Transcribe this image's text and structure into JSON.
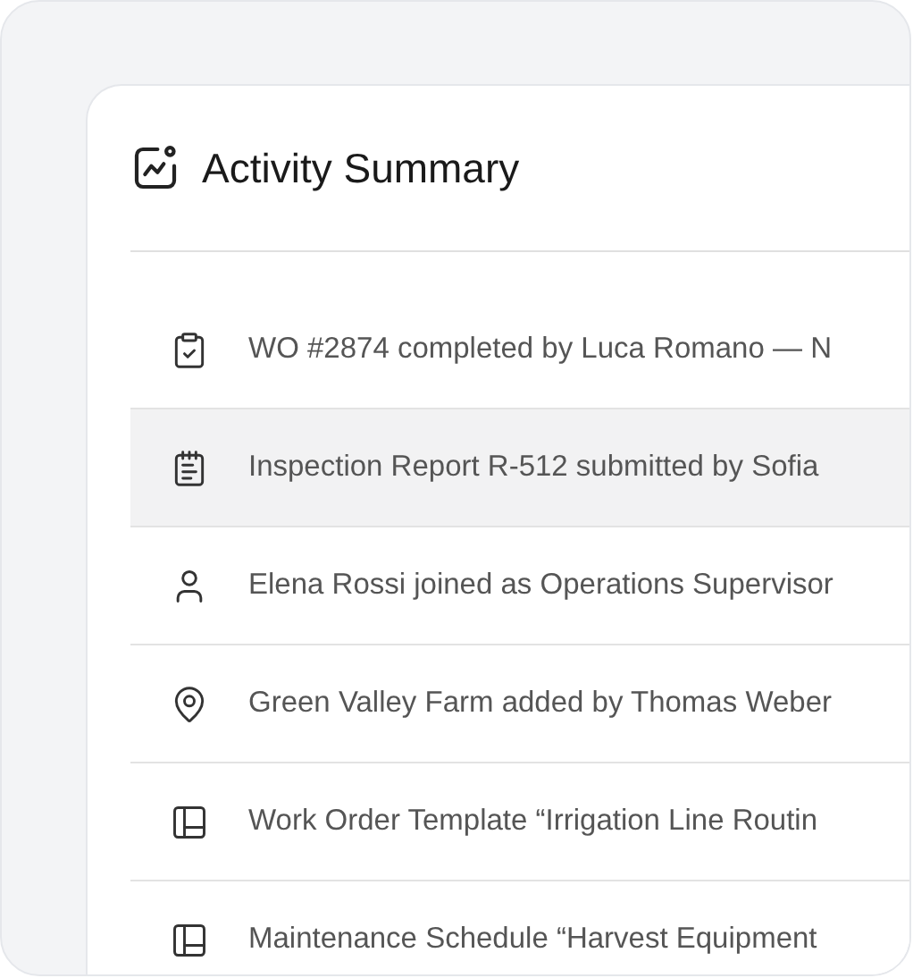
{
  "card": {
    "title": "Activity Summary"
  },
  "activities": [
    {
      "kind": "work-order",
      "text": "WO #2874 completed by Luca Romano — N",
      "selected": false
    },
    {
      "kind": "report",
      "text": "Inspection Report R-512 submitted by Sofia",
      "selected": true
    },
    {
      "kind": "user",
      "text": "Elena Rossi joined as Operations Supervisor",
      "selected": false
    },
    {
      "kind": "location",
      "text": "Green Valley Farm added by Thomas Weber",
      "selected": false
    },
    {
      "kind": "template",
      "text": "Work Order Template “Irrigation Line Routin",
      "selected": false
    },
    {
      "kind": "template",
      "text": "Maintenance Schedule “Harvest Equipment",
      "selected": false
    }
  ]
}
